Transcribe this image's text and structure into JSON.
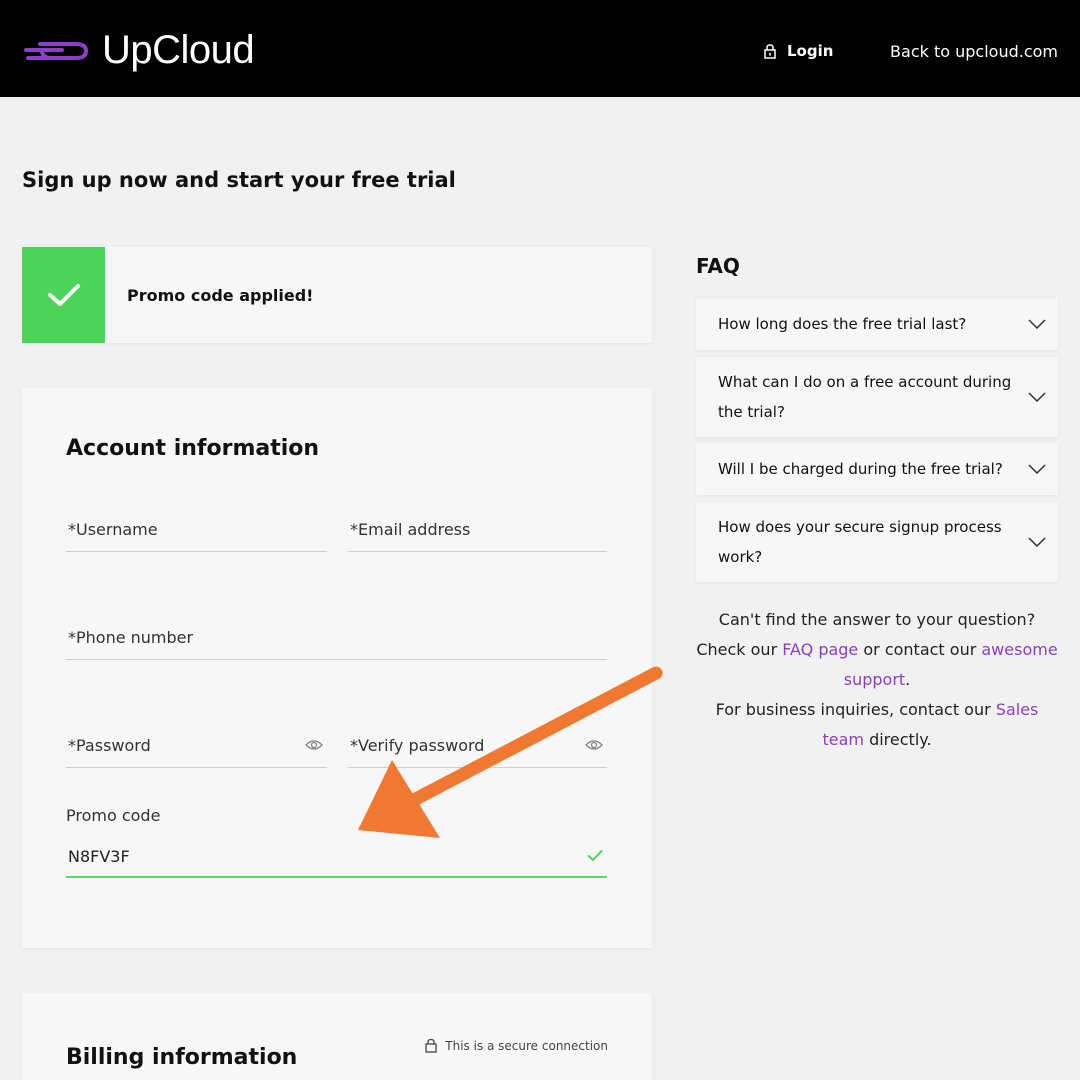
{
  "header": {
    "brand": "UpCloud",
    "login_label": "Login",
    "back_label": "Back to upcloud.com"
  },
  "page_title": "Sign up now and start your free trial",
  "promo_banner": {
    "text": "Promo code applied!"
  },
  "account": {
    "title": "Account information",
    "username_placeholder": "*Username",
    "email_placeholder": "*Email address",
    "phone_placeholder": "*Phone number",
    "password_placeholder": "*Password",
    "verify_placeholder": "*Verify password",
    "promo_label": "Promo code",
    "promo_value": "N8FV3F"
  },
  "billing": {
    "title": "Billing information",
    "secure_text": "This is a secure connection"
  },
  "faq": {
    "title": "FAQ",
    "items": [
      "How long does the free trial last?",
      "What can I do on a free account during the trial?",
      "Will I be charged during the free trial?",
      "How does your secure signup process work?"
    ]
  },
  "help": {
    "line1": "Can't find the answer to your question?",
    "line2_pre": "Check our ",
    "faq_link": "FAQ page",
    "line2_mid": " or contact our ",
    "support_link": "awesome support",
    "line2_end": ".",
    "line3_pre": "For business inquiries, contact our ",
    "sales_link": "Sales team",
    "line3_end": " directly."
  },
  "colors": {
    "brand_purple": "#8a3fc4",
    "success_green": "#4cd45a",
    "annotation_arrow": "#f07830"
  }
}
